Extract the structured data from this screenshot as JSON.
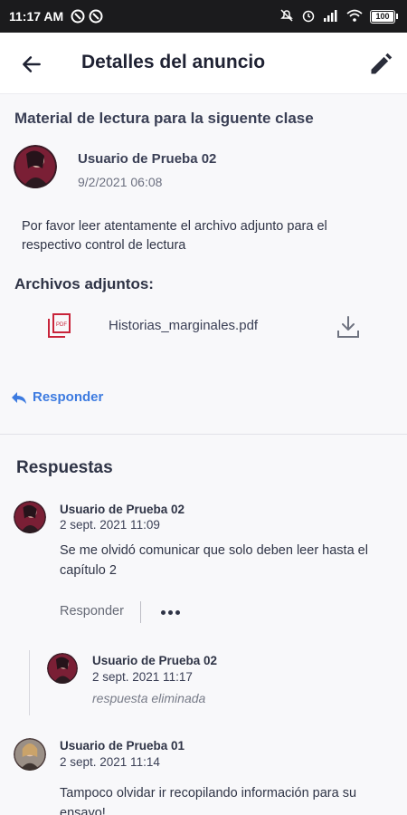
{
  "status_bar": {
    "time": "11:17 AM",
    "battery": "100"
  },
  "app_bar": {
    "title": "Detalles del anuncio",
    "back_icon": "arrow-left-icon",
    "edit_icon": "pencil-icon"
  },
  "post": {
    "title": "Material de lectura para la siguente clase",
    "author": "Usuario de Prueba 02",
    "date": "9/2/2021 06:08",
    "body": "Por favor leer atentamente el archivo adjunto para el respectivo control de lectura",
    "attachments_heading": "Archivos adjuntos:",
    "attachments": [
      {
        "file_name": "Historias_marginales.pdf",
        "icon": "pdf-icon"
      }
    ],
    "reply_label": "Responder"
  },
  "responses": {
    "heading": "Respuestas",
    "items": [
      {
        "author": "Usuario de Prueba 02",
        "date": "2 sept. 2021 11:09",
        "text": "Se me olvidó comunicar que solo deben leer hasta el capítulo 2",
        "reply_label": "Responder",
        "replies": [
          {
            "author": "Usuario de Prueba 02",
            "date": "2 sept. 2021 11:17",
            "text": "respuesta eliminada"
          }
        ]
      },
      {
        "author": "Usuario de Prueba 01",
        "date": "2 sept. 2021 11:14",
        "text": "Tampoco olvidar ir recopilando información para su ensayo!"
      }
    ]
  },
  "colors": {
    "accent": "#3d7be0",
    "pdf": "#c8243a",
    "status_bar": "#1b1b1d"
  }
}
